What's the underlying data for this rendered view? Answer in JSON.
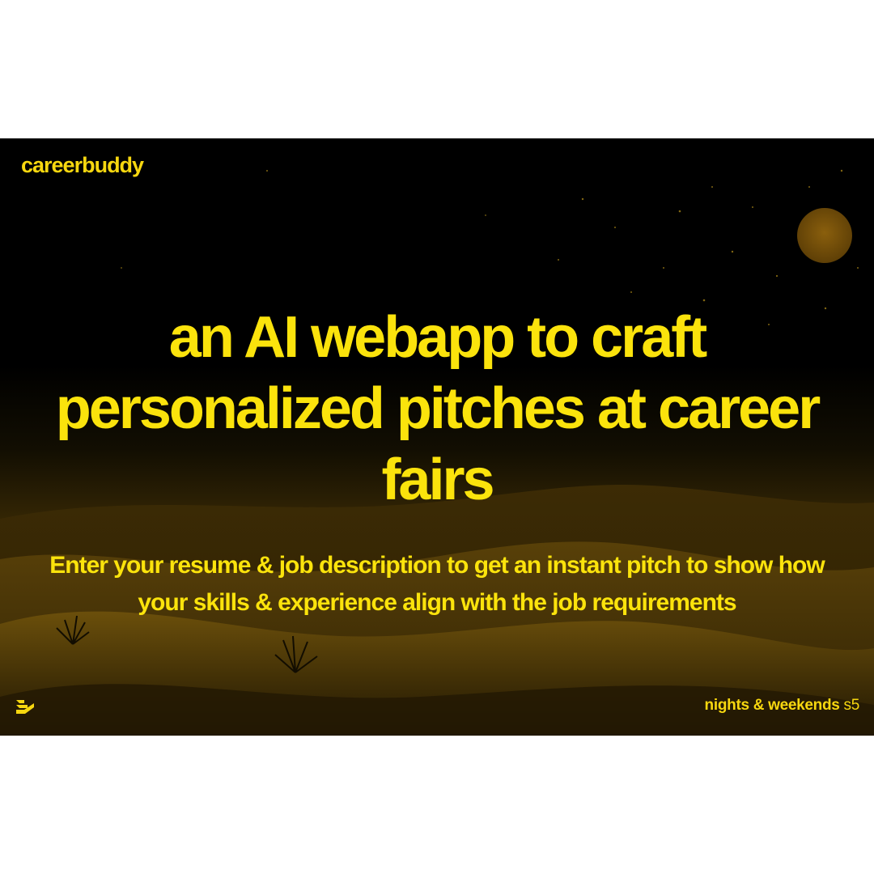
{
  "brand": {
    "name": "careerbuddy"
  },
  "hero": {
    "headline": "an AI webapp to craft personalized pitches at career fairs",
    "subtext": "Enter your resume & job description to get an instant pitch to show how your skills & experience align with the job requirements"
  },
  "footer": {
    "program_label": "nights & weekends",
    "season_label": "s5",
    "logo_icon": "buildspace-logo-icon"
  },
  "colors": {
    "accent": "#fbe30c",
    "background": "#000000",
    "sand": "#4a3507"
  }
}
